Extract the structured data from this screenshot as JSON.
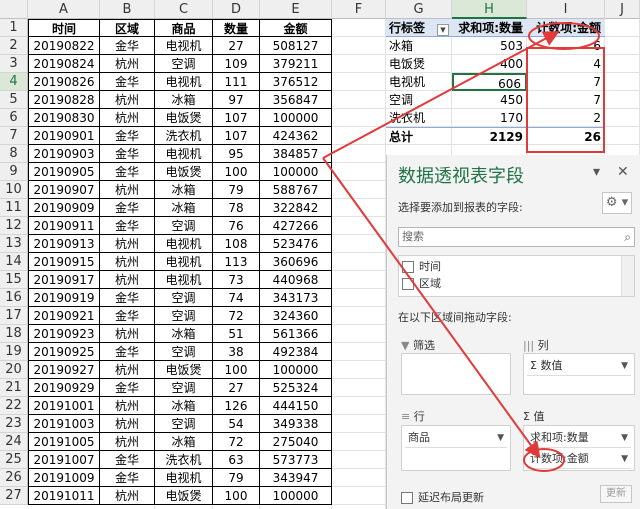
{
  "columns": [
    "A",
    "B",
    "C",
    "D",
    "E",
    "F",
    "G",
    "H",
    "I",
    "J"
  ],
  "table_header": {
    "time": "时间",
    "region": "区域",
    "product": "商品",
    "qty": "数量",
    "amount": "金额"
  },
  "rows": [
    [
      "20190822",
      "金华",
      "电视机",
      "27",
      "508127"
    ],
    [
      "20190824",
      "杭州",
      "空调",
      "109",
      "379211"
    ],
    [
      "20190826",
      "金华",
      "电视机",
      "111",
      "376512"
    ],
    [
      "20190828",
      "杭州",
      "冰箱",
      "97",
      "356847"
    ],
    [
      "20190830",
      "杭州",
      "电饭煲",
      "107",
      "100000"
    ],
    [
      "20190901",
      "金华",
      "洗衣机",
      "107",
      "424362"
    ],
    [
      "20190903",
      "金华",
      "电视机",
      "95",
      "384857"
    ],
    [
      "20190905",
      "金华",
      "电饭煲",
      "100",
      "100000"
    ],
    [
      "20190907",
      "杭州",
      "冰箱",
      "79",
      "588767"
    ],
    [
      "20190909",
      "金华",
      "冰箱",
      "78",
      "322842"
    ],
    [
      "20190911",
      "金华",
      "空调",
      "76",
      "427266"
    ],
    [
      "20190913",
      "杭州",
      "电视机",
      "108",
      "523476"
    ],
    [
      "20190915",
      "杭州",
      "电视机",
      "113",
      "360696"
    ],
    [
      "20190917",
      "杭州",
      "电视机",
      "73",
      "440968"
    ],
    [
      "20190919",
      "金华",
      "空调",
      "74",
      "343173"
    ],
    [
      "20190921",
      "金华",
      "空调",
      "72",
      "324360"
    ],
    [
      "20190923",
      "杭州",
      "冰箱",
      "51",
      "561366"
    ],
    [
      "20190925",
      "金华",
      "空调",
      "38",
      "492384"
    ],
    [
      "20190927",
      "杭州",
      "电饭煲",
      "100",
      "100000"
    ],
    [
      "20190929",
      "金华",
      "空调",
      "27",
      "525324"
    ],
    [
      "20191001",
      "杭州",
      "冰箱",
      "126",
      "444150"
    ],
    [
      "20191003",
      "杭州",
      "空调",
      "54",
      "349338"
    ],
    [
      "20191005",
      "杭州",
      "冰箱",
      "72",
      "275040"
    ],
    [
      "20191007",
      "金华",
      "洗衣机",
      "63",
      "573773"
    ],
    [
      "20191009",
      "金华",
      "电视机",
      "79",
      "343947"
    ],
    [
      "20191011",
      "杭州",
      "电饭煲",
      "100",
      "100000"
    ]
  ],
  "pivot": {
    "header": [
      "行标签",
      "求和项:数量",
      "计数项:金额"
    ],
    "rows": [
      [
        "冰箱",
        "503",
        "6"
      ],
      [
        "电饭煲",
        "400",
        "4"
      ],
      [
        "电视机",
        "606",
        "7"
      ],
      [
        "空调",
        "450",
        "7"
      ],
      [
        "洗衣机",
        "170",
        "2"
      ]
    ],
    "total": [
      "总计",
      "2129",
      "26"
    ]
  },
  "pane": {
    "title": "数据透视表字段",
    "subtitle": "选择要添加到报表的字段:",
    "search_placeholder": "搜索",
    "fields": [
      "时间",
      "区域"
    ],
    "drag_label": "在以下区域间拖动字段:",
    "filter_label": "筛选",
    "columns_label": "列",
    "columns_value": "Σ 数值",
    "rows_label": "行",
    "rows_value": "商品",
    "values_label": "Σ 值",
    "values_items": [
      "求和项:数量",
      "计数项:金额"
    ],
    "defer_label": "延迟布局更新",
    "update_label": "更新"
  },
  "icons": [
    "close-icon",
    "gear-icon",
    "search-icon",
    "dropdown-icon"
  ],
  "colors": {
    "excel_green": "#217346",
    "annotation_red": "#e23a3a",
    "pivot_header": "#dde6f4"
  }
}
